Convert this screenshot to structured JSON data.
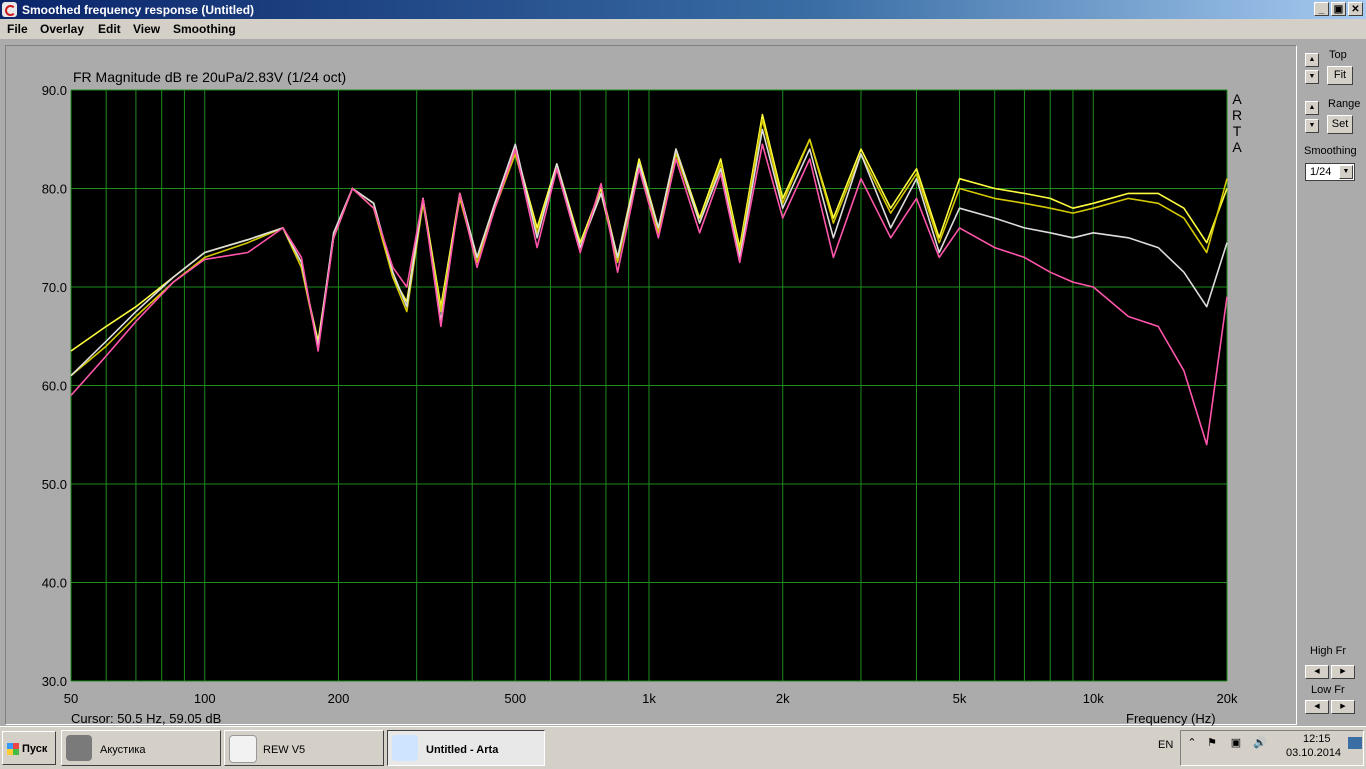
{
  "window": {
    "title": "Smoothed frequency response (Untitled)"
  },
  "menu": [
    "File",
    "Overlay",
    "Edit",
    "View",
    "Smoothing"
  ],
  "chart_title": "FR Magnitude dB re 20uPa/2.83V (1/24 oct)",
  "brand_letters": [
    "A",
    "R",
    "T",
    "A"
  ],
  "cursor_readout": "Cursor: 50.5 Hz, 59.05 dB",
  "x_axis_label": "Frequency (Hz)",
  "controls": {
    "top_label": "Top",
    "fit_label": "Fit",
    "range_label": "Range",
    "set_label": "Set",
    "smoothing_label": "Smoothing",
    "smoothing_value": "1/24",
    "high_fr_label": "High Fr",
    "low_fr_label": "Low Fr"
  },
  "taskbar": {
    "start_label": "Пуск",
    "tasks": [
      {
        "label": "Акустика",
        "active": false
      },
      {
        "label": "REW V5",
        "active": false
      },
      {
        "label": "Untitled - Arta",
        "active": true
      }
    ],
    "language": "EN",
    "time": "12:15",
    "date": "03.10.2014"
  },
  "chart_data": {
    "type": "line",
    "title": "FR Magnitude dB re 20uPa/2.83V (1/24 oct)",
    "xlabel": "Frequency (Hz)",
    "ylabel": "",
    "x_scale": "log",
    "xlim": [
      50,
      20000
    ],
    "ylim": [
      30,
      90
    ],
    "grid": true,
    "background": "#000000",
    "grid_color": "#1e8c1e",
    "y_ticks": [
      "30.0",
      "40.0",
      "50.0",
      "60.0",
      "70.0",
      "80.0",
      "90.0"
    ],
    "x_ticks": [
      {
        "v": 50,
        "label": "50"
      },
      {
        "v": 100,
        "label": "100"
      },
      {
        "v": 200,
        "label": "200"
      },
      {
        "v": 500,
        "label": "500"
      },
      {
        "v": 1000,
        "label": "1k"
      },
      {
        "v": 2000,
        "label": "2k"
      },
      {
        "v": 5000,
        "label": "5k"
      },
      {
        "v": 10000,
        "label": "10k"
      },
      {
        "v": 20000,
        "label": "20k"
      }
    ],
    "x": [
      50,
      60,
      70,
      85,
      100,
      125,
      150,
      165,
      180,
      195,
      215,
      240,
      265,
      285,
      310,
      340,
      375,
      410,
      450,
      500,
      560,
      620,
      700,
      780,
      850,
      950,
      1050,
      1150,
      1300,
      1450,
      1600,
      1800,
      2000,
      2300,
      2600,
      3000,
      3500,
      4000,
      4500,
      5000,
      6000,
      7000,
      8000,
      9000,
      10000,
      12000,
      14000,
      16000,
      18000,
      20000
    ],
    "series": [
      {
        "color": "#ffff40",
        "values": [
          63.5,
          66,
          68,
          71,
          73.5,
          74.8,
          76,
          72,
          64.5,
          75,
          80,
          78.5,
          71,
          68.5,
          79,
          68,
          79.5,
          73,
          78.5,
          84,
          76,
          82.5,
          74.5,
          80,
          73,
          83,
          76,
          84,
          77,
          83,
          74,
          87.5,
          79,
          85,
          77,
          84,
          78,
          82,
          75,
          81,
          80,
          79.5,
          79,
          78,
          78.5,
          79.5,
          79.5,
          78,
          74.5,
          80
        ]
      },
      {
        "color": "#d4c800",
        "values": [
          61,
          64,
          67,
          70.5,
          73,
          74.5,
          76,
          72,
          64,
          75,
          80,
          78,
          71,
          67.5,
          78.5,
          67.5,
          79,
          72.5,
          78,
          83.5,
          75.5,
          82,
          74,
          79.5,
          72.5,
          82.5,
          75.5,
          83.5,
          76.5,
          82.5,
          73.5,
          87,
          78.5,
          85,
          76.5,
          83.5,
          77.5,
          81.5,
          74.5,
          80,
          79,
          78.5,
          78,
          77.5,
          78,
          79,
          78.5,
          77,
          73.5,
          81
        ]
      },
      {
        "color": "#dcdcdc",
        "values": [
          61,
          64.5,
          67.5,
          71,
          73.5,
          74.8,
          76,
          72.5,
          64,
          75.5,
          80,
          78.5,
          71.5,
          68,
          79,
          66.5,
          79.5,
          73,
          78.5,
          84.5,
          75,
          82.5,
          74,
          79.5,
          73,
          82.5,
          76,
          84,
          76.5,
          82,
          73,
          86,
          78,
          84,
          75,
          83.5,
          76,
          81,
          73.5,
          78,
          77,
          76,
          75.5,
          75,
          75.5,
          75,
          74,
          71.5,
          68,
          74.5
        ]
      },
      {
        "color": "#ff55aa",
        "values": [
          59,
          63,
          66.5,
          70.5,
          72.8,
          73.5,
          76,
          73,
          63.5,
          75,
          80,
          78,
          72,
          70,
          79,
          66,
          79.5,
          72,
          78,
          84,
          74,
          82,
          73.5,
          80.5,
          71.5,
          82,
          75,
          83,
          75.5,
          81.5,
          72.5,
          84.5,
          77,
          83,
          73,
          81,
          75,
          79,
          73,
          76,
          74,
          73,
          71.5,
          70.5,
          70,
          67,
          66,
          61.5,
          54,
          69
        ]
      }
    ]
  }
}
